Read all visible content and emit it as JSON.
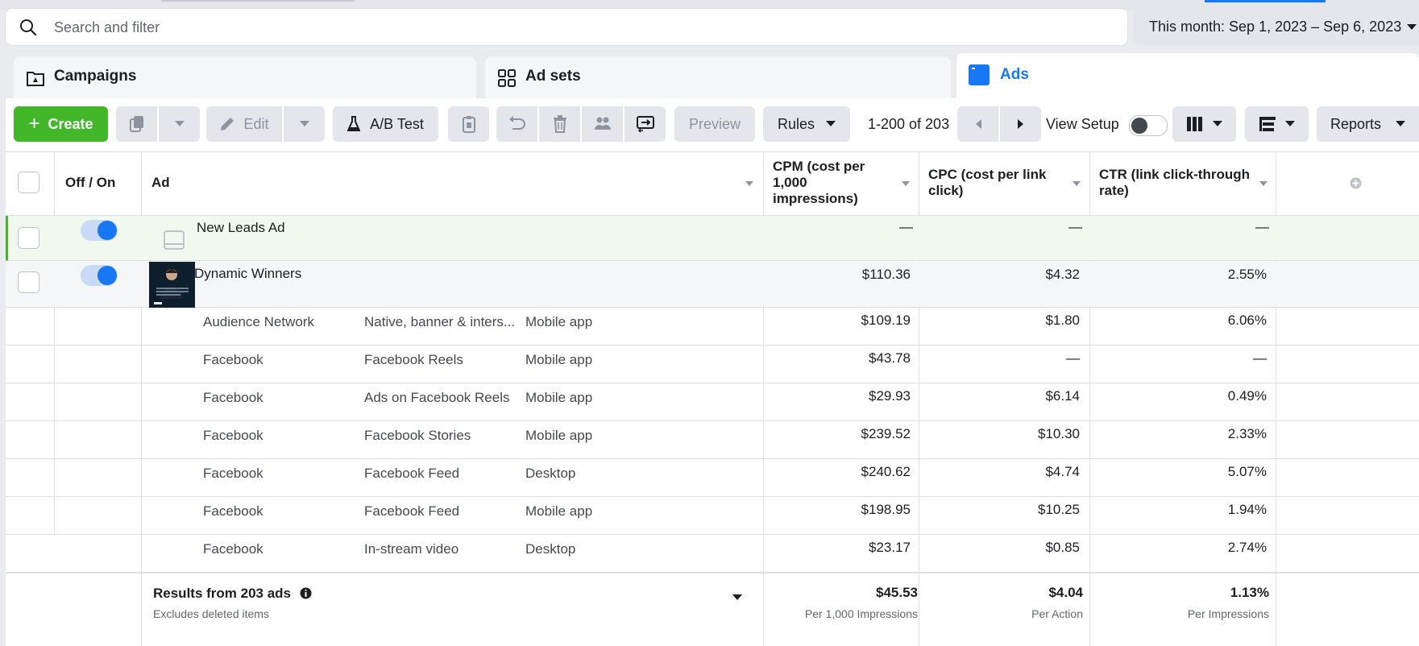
{
  "search": {
    "placeholder": "Search and filter"
  },
  "date_range": {
    "label": "This month: Sep 1, 2023 – Sep 6, 2023"
  },
  "tabs": [
    {
      "label": "Campaigns",
      "icon": "folder-icon"
    },
    {
      "label": "Ad sets",
      "icon": "grid-icon"
    },
    {
      "label": "Ads",
      "icon": "ad-icon",
      "active": true
    }
  ],
  "toolbar": {
    "create_label": "Create",
    "edit_label": "Edit",
    "ab_test_label": "A/B Test",
    "preview_label": "Preview",
    "rules_label": "Rules",
    "pagination": "1-200 of 203",
    "view_setup_label": "View Setup",
    "reports_label": "Reports"
  },
  "table": {
    "columns": {
      "offon": "Off / On",
      "ad": "Ad",
      "cpm": "CPM (cost per 1,000 impressions)",
      "cpc": "CPC (cost per link click)",
      "ctr": "CTR (link click-through rate)"
    },
    "ads": [
      {
        "name": "New Leads Ad",
        "on": true,
        "cpm": "—",
        "cpc": "—",
        "ctr": "—"
      },
      {
        "name": "Dynamic Winners",
        "on": true,
        "cpm": "$110.36",
        "cpc": "$4.32",
        "ctr": "2.55%"
      }
    ],
    "breakdown": [
      {
        "platform": "Audience Network",
        "placement": "Native, banner & inters...",
        "device": "Mobile app",
        "cpm": "$109.19",
        "cpc": "$1.80",
        "ctr": "6.06%"
      },
      {
        "platform": "Facebook",
        "placement": "Facebook Reels",
        "device": "Mobile app",
        "cpm": "$43.78",
        "cpc": "—",
        "ctr": "—"
      },
      {
        "platform": "Facebook",
        "placement": "Ads on Facebook Reels",
        "device": "Mobile app",
        "cpm": "$29.93",
        "cpc": "$6.14",
        "ctr": "0.49%"
      },
      {
        "platform": "Facebook",
        "placement": "Facebook Stories",
        "device": "Mobile app",
        "cpm": "$239.52",
        "cpc": "$10.30",
        "ctr": "2.33%"
      },
      {
        "platform": "Facebook",
        "placement": "Facebook Feed",
        "device": "Desktop",
        "cpm": "$240.62",
        "cpc": "$4.74",
        "ctr": "5.07%"
      },
      {
        "platform": "Facebook",
        "placement": "Facebook Feed",
        "device": "Mobile app",
        "cpm": "$198.95",
        "cpc": "$10.25",
        "ctr": "1.94%"
      },
      {
        "platform": "Facebook",
        "placement": "In-stream video",
        "device": "Desktop",
        "cpm": "$23.17",
        "cpc": "$0.85",
        "ctr": "2.74%"
      }
    ],
    "footer": {
      "title": "Results from 203 ads",
      "subtitle": "Excludes deleted items",
      "cpm": "$45.53",
      "cpm_sub": "Per 1,000 Impressions",
      "cpc": "$4.04",
      "cpc_sub": "Per Action",
      "ctr": "1.13%",
      "ctr_sub": "Per Impressions"
    }
  },
  "colors": {
    "accent": "#1877f2",
    "create": "#42b72a",
    "new_row": "#f1f8ee"
  }
}
